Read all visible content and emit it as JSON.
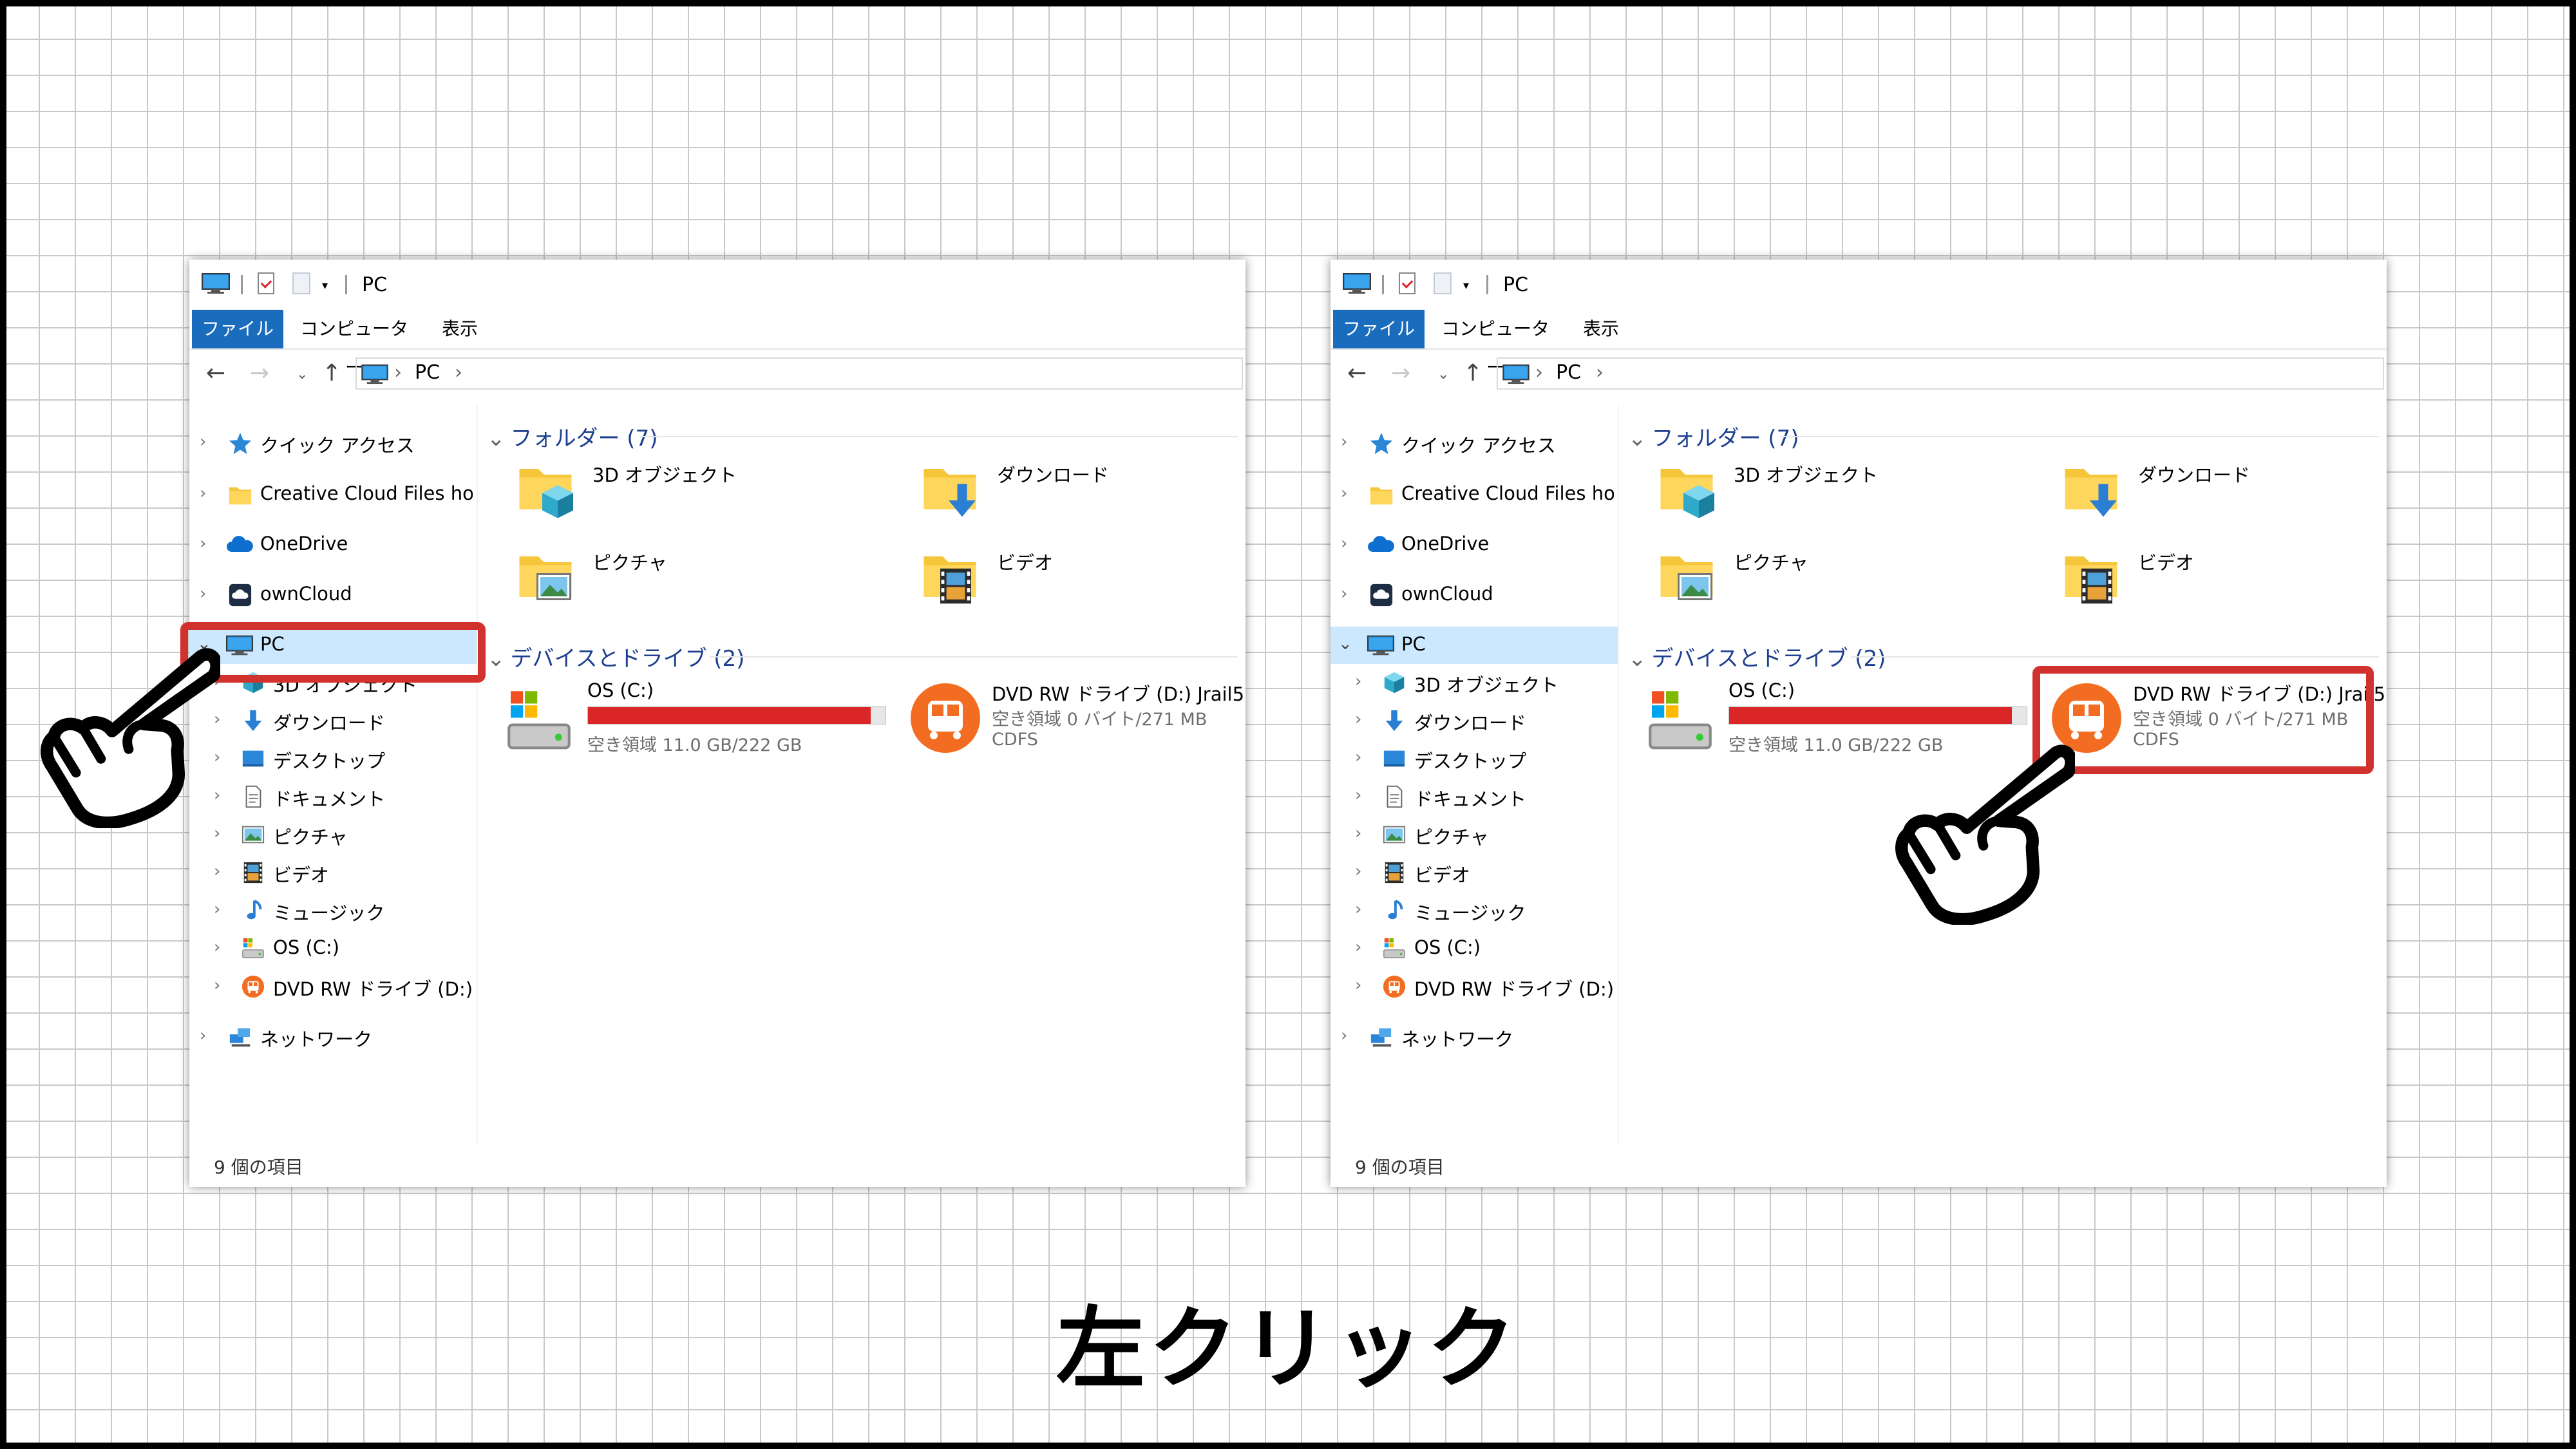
{
  "caption": "左クリック",
  "explorer": {
    "title": "PC",
    "ribbon_tabs": [
      "ファイル",
      "コンピューター",
      "表示"
    ],
    "address": "PC",
    "sidebar": {
      "quick_access": "クイック アクセス",
      "creative_cloud": "Creative Cloud Files  hone",
      "onedrive": "OneDrive",
      "owncloud": "ownCloud",
      "pc": "PC",
      "children": [
        "3D オブジェクト",
        "ダウンロード",
        "デスクトップ",
        "ドキュメント",
        "ピクチャ",
        "ビデオ",
        "ミュージック",
        "OS (C:)",
        "DVD RW ドライブ (D:) Jrail"
      ],
      "network": "ネットワーク"
    },
    "folders_header": "フォルダー (7)",
    "folders": [
      "3D オブジェクト",
      "ダウンロード",
      "ピクチャ",
      "ビデオ"
    ],
    "drives_header": "デバイスとドライブ (2)",
    "drive_c": {
      "name": "OS (C:)",
      "free": "空き領域 11.0 GB/222 GB",
      "used_fraction": 0.95
    },
    "drive_d": {
      "name": "DVD RW ドライブ (D:) Jrail5",
      "free": "空き領域 0 バイト/271 MB",
      "fs": "CDFS"
    },
    "status": "9 個の項目"
  },
  "colors": {
    "highlight": "#d2322e",
    "selection": "#cce8ff",
    "ribbon_file": "#1a6cbc",
    "drive_bar": "#da2626",
    "group_header": "#1e3f8f"
  },
  "icons": [
    "pc-icon",
    "star-icon",
    "folder-icon",
    "cloud-icon",
    "owncloud-icon",
    "cube-icon",
    "download-icon",
    "desktop-icon",
    "document-icon",
    "picture-icon",
    "video-icon",
    "music-icon",
    "drive-icon",
    "dvd-icon",
    "network-icon",
    "pointing-hand-icon"
  ]
}
